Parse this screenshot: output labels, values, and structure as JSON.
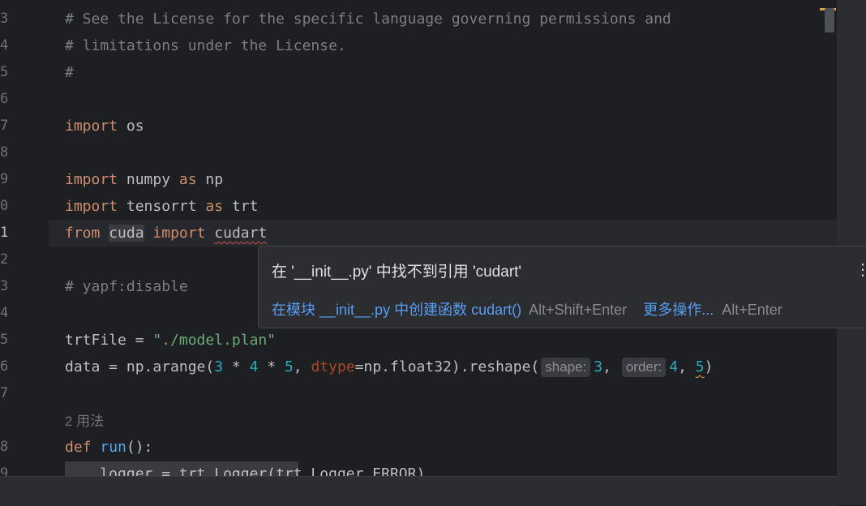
{
  "gutter": {
    "line_numbers": [
      "3",
      "4",
      "5",
      "6",
      "7",
      "8",
      "9",
      "0",
      "1",
      "2",
      "3",
      "4",
      "5",
      "6",
      "7",
      "",
      "8",
      "9"
    ]
  },
  "code": {
    "l3": "# See the License for the specific language governing permissions and",
    "l4": "# limitations under the License.",
    "l5": "#",
    "l7_kw": "import",
    "l7_rest": " os",
    "l9_kw1": "import",
    "l9_mid": " numpy ",
    "l9_kw2": "as",
    "l9_rest": " np",
    "l10_kw1": "import",
    "l10_mid": " tensorrt ",
    "l10_kw2": "as",
    "l10_rest": " trt",
    "l11_kw1": "from",
    "l11_sp1": " ",
    "l11_mod": "cuda",
    "l11_sp2": " ",
    "l11_kw2": "import",
    "l11_sp3": " ",
    "l11_name": "cudart",
    "l13": "# yapf:disable",
    "l15_a": "trtFile = ",
    "l15_str": "\"./model.plan\"",
    "l16_a": "data = np.arange(",
    "l16_n1": "3",
    "l16_op1": " * ",
    "l16_n2": "4",
    "l16_op2": " * ",
    "l16_n3": "5",
    "l16_c": ", ",
    "l16_param": "dtype",
    "l16_b": "=np.float32).reshape(",
    "l16_hint1": "shape:",
    "l16_n4": "3",
    "l16_c2": ", ",
    "l16_hint2": "order:",
    "l16_n5": "4",
    "l16_c3": ", ",
    "l16_n6": "5",
    "l16_end": ")",
    "usages": "2 用法",
    "l18_kw": "def",
    "l18_sp": " ",
    "l18_fn": "run",
    "l18_rest": "():",
    "l19": "    logger = trt.Logger(trt.Logger.ERROR)"
  },
  "popup": {
    "message": "在 '__init__.py' 中找不到引用 'cudart'",
    "action1": "在模块 __init__.py 中创建函数 cudart()",
    "action1_shortcut": "Alt+Shift+Enter",
    "action2": "更多操作...",
    "action2_shortcut": "Alt+Enter",
    "menu_icon": "kebab-icon"
  },
  "colors": {
    "background": "#1e1f22",
    "keyword": "#cf8e6d",
    "comment": "#7a7e85",
    "string": "#6aab73",
    "number": "#2aacb8",
    "link": "#589df6"
  }
}
